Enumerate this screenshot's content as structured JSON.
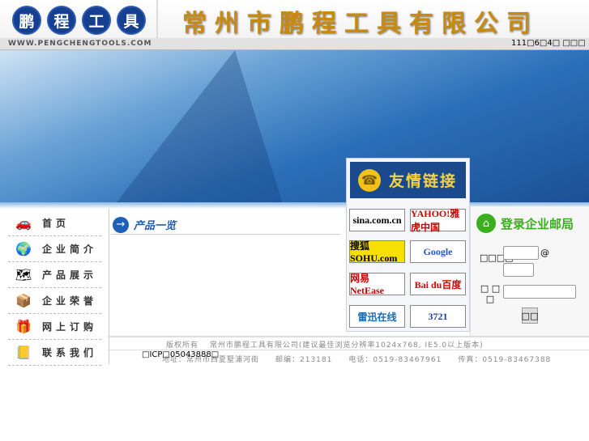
{
  "header": {
    "logo_chars": [
      "鹏",
      "程",
      "工",
      "具"
    ],
    "company_title": "常州市鹏程工具有限公司",
    "url": "WWW.PENGCHENGTOOLS.COM",
    "date": "111□6□4□ □□□"
  },
  "friend_links": {
    "title": "友情链接",
    "items": [
      {
        "label": "sina.com.cn",
        "color": "#000"
      },
      {
        "label": "YAHOO!雅虎中国",
        "color": "#c00"
      },
      {
        "label": "搜狐 SOHU.com",
        "color": "#000"
      },
      {
        "label": "Google",
        "color": "#2255cc"
      },
      {
        "label": "网易 NetEase",
        "color": "#c00"
      },
      {
        "label": "Bai du百度",
        "color": "#d00"
      },
      {
        "label": "雷迅在线",
        "color": "#1a6bb5"
      },
      {
        "label": "3721",
        "color": "#1a3f9c"
      }
    ]
  },
  "nav": {
    "items": [
      {
        "label": "首页",
        "icon": "car-icon",
        "glyph": "🚗"
      },
      {
        "label": "企业简介",
        "icon": "globe-icon",
        "glyph": "🌍"
      },
      {
        "label": "产品展示",
        "icon": "map-icon",
        "glyph": "🗺"
      },
      {
        "label": "企业荣誉",
        "icon": "box-icon",
        "glyph": "📦"
      },
      {
        "label": "网上订购",
        "icon": "gift-icon",
        "glyph": "🎁"
      },
      {
        "label": "联系我们",
        "icon": "book-icon",
        "glyph": "📒"
      }
    ]
  },
  "products": {
    "title": "产品一览"
  },
  "login": {
    "title": "登录企业邮局",
    "user_label": "□□□□",
    "at": "@",
    "pass_label": "□ □ □",
    "submit": "□□"
  },
  "footer": {
    "line1": "版权所有　 常州市鹏程工具有限公司(建议最佳浏览分辨率1024x768, IE5.0以上版本)",
    "line2": "地址：常州市西夏墅浦河街　　邮编：213181　　电话：0519-83467961　　传真：0519-83467388",
    "icp": "□ICP□05043888□"
  }
}
